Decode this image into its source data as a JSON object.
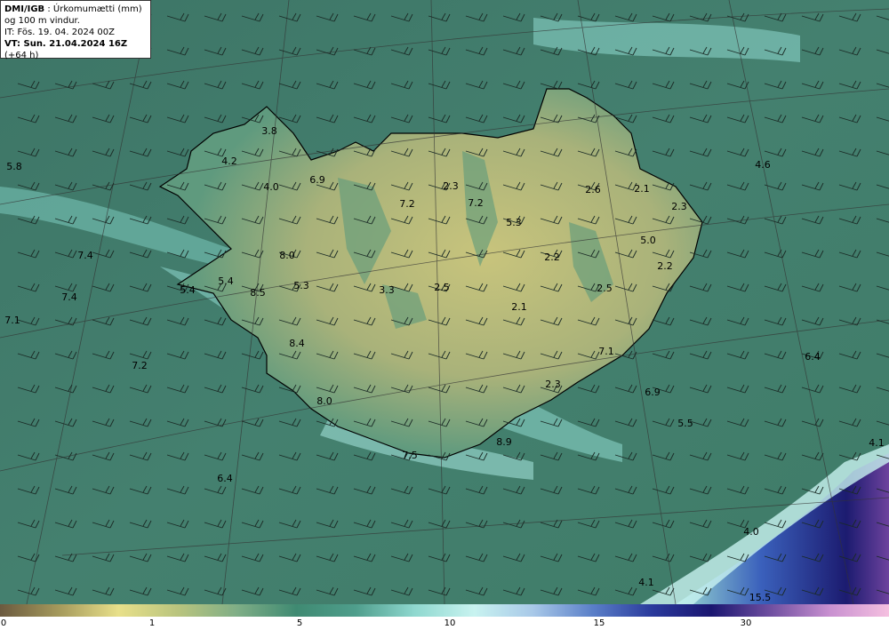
{
  "header": {
    "source": "DMI/IGB",
    "variable": " : Úrkomumætti (mm)",
    "line2": "og 100 m vindur.",
    "issue_time": "IT: Fös. 19. 04. 2024 00Z",
    "valid_prefix": "VT: Sun. 21.04.2024 16Z",
    "valid_suffix": " (+64 h)"
  },
  "colorbar": {
    "ticks": [
      "0",
      "1",
      "5",
      "10",
      "15",
      "30"
    ],
    "colors": [
      "#6b5a3f",
      "#a59a5c",
      "#e8e08a",
      "#b9c47e",
      "#7fae86",
      "#3f8a72",
      "#4f9e8c",
      "#8fd8cf",
      "#c8f3f0",
      "#a8c8e8",
      "#5a7fc8",
      "#2a3a9c",
      "#1a1670",
      "#6f4fa0",
      "#c890d0",
      "#f5c0e0"
    ]
  },
  "values": [
    {
      "label": "3.8"
    },
    {
      "label": "4.2"
    },
    {
      "label": "5.8"
    },
    {
      "label": "4.0"
    },
    {
      "label": "6.9"
    },
    {
      "label": "7.2"
    },
    {
      "label": "2.3"
    },
    {
      "label": "7.2"
    },
    {
      "label": "2.6"
    },
    {
      "label": "2.1"
    },
    {
      "label": "4.6"
    },
    {
      "label": "2.3"
    },
    {
      "label": "5.3"
    },
    {
      "label": "5.0"
    },
    {
      "label": "7.4"
    },
    {
      "label": "8.0"
    },
    {
      "label": "2.2"
    },
    {
      "label": "2.2"
    },
    {
      "label": "5.4"
    },
    {
      "label": "5.4"
    },
    {
      "label": "8.5"
    },
    {
      "label": "5.3"
    },
    {
      "label": "3.3"
    },
    {
      "label": "2.5"
    },
    {
      "label": "2.5"
    },
    {
      "label": "7.4"
    },
    {
      "label": "2.1"
    },
    {
      "label": "7.1"
    },
    {
      "label": "8.4"
    },
    {
      "label": "7.1"
    },
    {
      "label": "6.4"
    },
    {
      "label": "7.2"
    },
    {
      "label": "2.3"
    },
    {
      "label": "6.9"
    },
    {
      "label": "8.0"
    },
    {
      "label": "5.5"
    },
    {
      "label": "8.9"
    },
    {
      "label": "4.1"
    },
    {
      "label": "7.5"
    },
    {
      "label": "6.4"
    },
    {
      "label": "4.0"
    },
    {
      "label": "4.1"
    },
    {
      "label": "15.5"
    }
  ],
  "colors": {
    "sea": "#3f7a6a",
    "land_low": "#c9c97a",
    "land_mid": "#6aa080",
    "coast": "#000000",
    "high_precip": "#9fe0d8",
    "extreme": "#1a1670"
  }
}
